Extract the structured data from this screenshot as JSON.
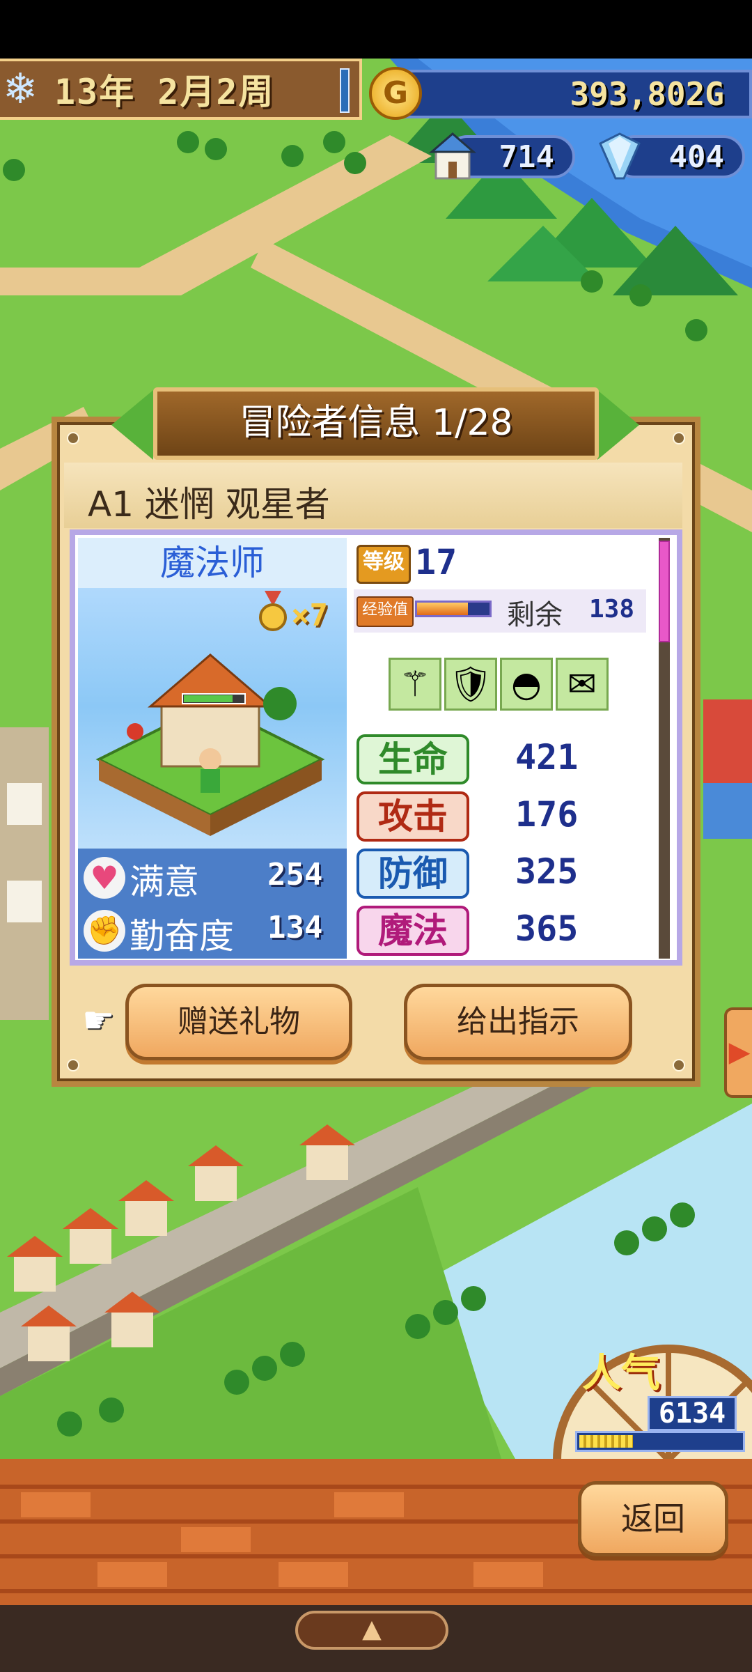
{
  "hud": {
    "date": "13年 2月2周",
    "gold": "393,802G",
    "population": "714",
    "crystals": "404"
  },
  "panel": {
    "title": "冒险者信息 1/28",
    "adventurer_name": "A1 迷惘 观星者",
    "job": "魔法师",
    "medal_count": "×7",
    "level_label": "等级",
    "level": "17",
    "exp_label": "经验值",
    "exp_remaining_label": "剩余",
    "exp_remaining": "138",
    "exp_progress": 0.7,
    "equipment": [
      "staff-icon",
      "armor-icon",
      "hat-icon",
      "charm-icon"
    ],
    "stats": [
      {
        "label": "生命",
        "value": "421",
        "color": "#2f8a2a",
        "bg": "#dff6d6"
      },
      {
        "label": "攻击",
        "value": "176",
        "color": "#b02a14",
        "bg": "#f8d8c8"
      },
      {
        "label": "防御",
        "value": "325",
        "color": "#1a5ab0",
        "bg": "#d6ecfa"
      },
      {
        "label": "魔法",
        "value": "365",
        "color": "#b01a7a",
        "bg": "#f8d6ec"
      }
    ],
    "satisfaction_label": "满意",
    "satisfaction": "254",
    "diligence_label": "勤奋度",
    "diligence": "134",
    "gift_button": "赠送礼物",
    "instruct_button": "给出指示"
  },
  "popularity": {
    "label": "人气",
    "value": "6134",
    "progress": 0.33
  },
  "back_button": "返回",
  "nav_handle": "▲"
}
